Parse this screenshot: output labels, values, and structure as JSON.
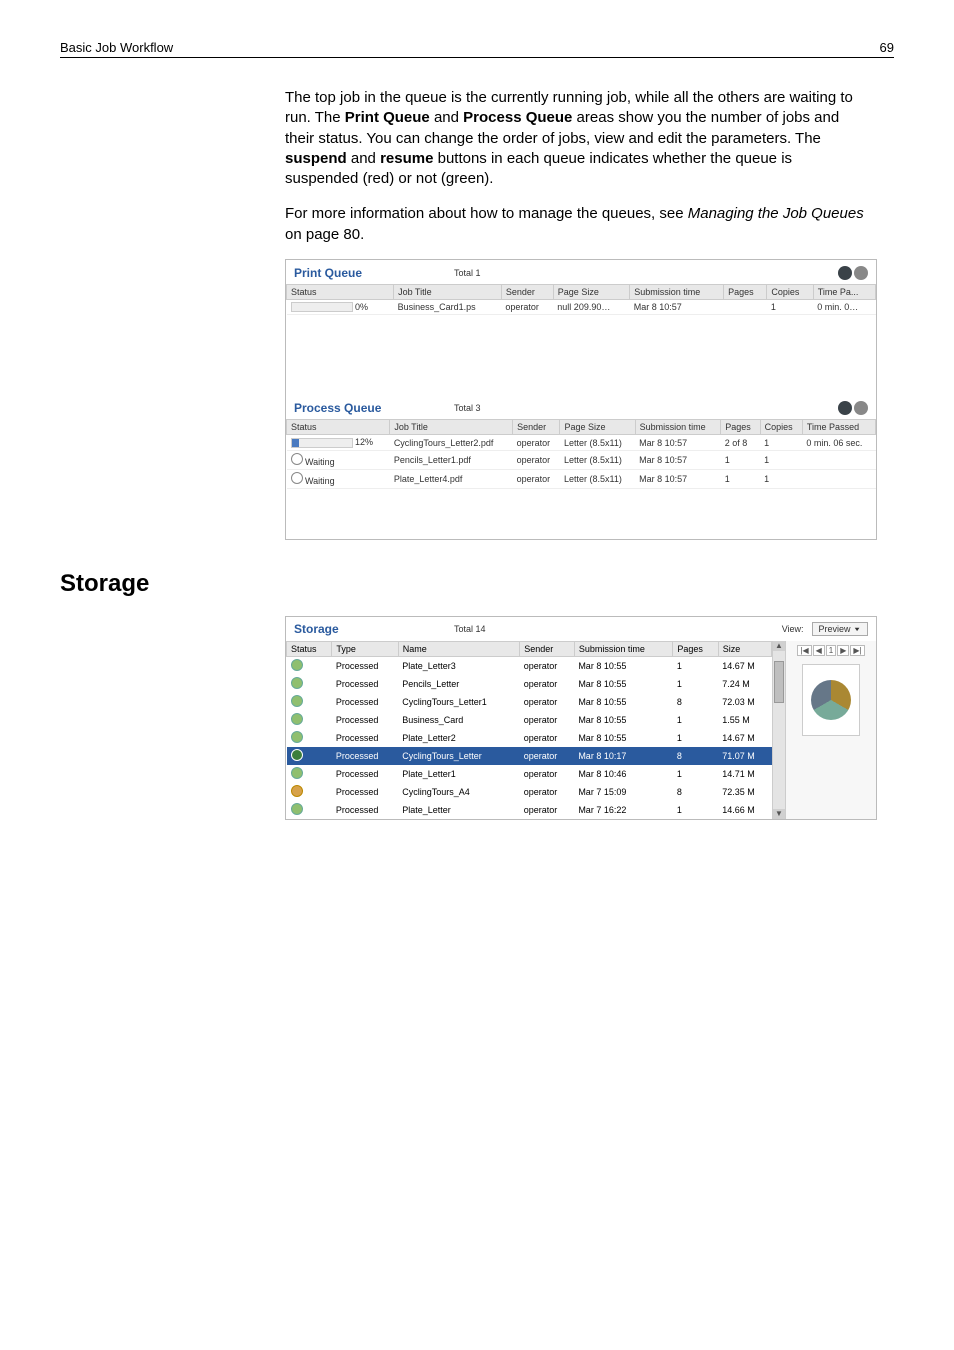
{
  "header": {
    "left": "Basic Job Workflow",
    "right": "69"
  },
  "para1_parts": {
    "a": "The top job in the queue is the currently running job, while all the others are waiting to run. The ",
    "b": "Print Queue",
    "c": " and ",
    "d": "Process Queue",
    "e": " areas show you the number of jobs and their status. You can change the order of jobs, view and edit the parameters. The ",
    "f": "suspend",
    "g": " and ",
    "h": "resume",
    "i": " buttons in each queue indicates whether the queue is suspended (red) or not (green)."
  },
  "para2_parts": {
    "a": "For more information about how to manage the queues, see ",
    "b": "Managing the Job Queues",
    "c": " on page 80."
  },
  "print_queue": {
    "title": "Print Queue",
    "total": "Total 1",
    "columns": [
      "Status",
      "Job Title",
      "Sender",
      "Page Size",
      "Submission time",
      "Pages",
      "Copies",
      "Time Pa..."
    ],
    "rows": [
      {
        "statusPct": "0%",
        "barPct": 0,
        "title": "Business_Card1.ps",
        "sender": "operator",
        "pageSize": "null 209.90…",
        "subTime": "Mar 8 10:57",
        "pages": "",
        "copies": "1",
        "time": "0 min. 0…"
      }
    ]
  },
  "process_queue": {
    "title": "Process Queue",
    "total": "Total 3",
    "columns": [
      "Status",
      "Job Title",
      "Sender",
      "Page Size",
      "Submission time",
      "Pages",
      "Copies",
      "Time Passed"
    ],
    "rows": [
      {
        "status": "12%",
        "barPct": 12,
        "title": "CyclingTours_Letter2.pdf",
        "sender": "operator",
        "pageSize": "Letter (8.5x11)",
        "subTime": "Mar 8 10:57",
        "pages": "2 of 8",
        "copies": "1",
        "time": "0 min. 06 sec."
      },
      {
        "status": "Waiting",
        "title": "Pencils_Letter1.pdf",
        "sender": "operator",
        "pageSize": "Letter (8.5x11)",
        "subTime": "Mar 8 10:57",
        "pages": "1",
        "copies": "1",
        "time": ""
      },
      {
        "status": "Waiting",
        "title": "Plate_Letter4.pdf",
        "sender": "operator",
        "pageSize": "Letter (8.5x11)",
        "subTime": "Mar 8 10:57",
        "pages": "1",
        "copies": "1",
        "time": ""
      }
    ]
  },
  "storage_heading": "Storage",
  "storage": {
    "title": "Storage",
    "total": "Total 14",
    "viewLabel": "View:",
    "preview": "Preview",
    "pager": [
      "|◀",
      "◀",
      "1",
      "▶",
      "▶|"
    ],
    "columns": [
      "Status",
      "Type",
      "Name",
      "Sender",
      "Submission time",
      "Pages",
      "Size"
    ],
    "rows": [
      {
        "type": "Processed",
        "name": "Plate_Letter3",
        "sender": "operator",
        "time": "Mar 8 10:55",
        "pages": "1",
        "size": "14.67 M",
        "sel": false,
        "kind": "ok"
      },
      {
        "type": "Processed",
        "name": "Pencils_Letter",
        "sender": "operator",
        "time": "Mar 8 10:55",
        "pages": "1",
        "size": "7.24 M",
        "sel": false,
        "kind": "ok"
      },
      {
        "type": "Processed",
        "name": "CyclingTours_Letter1",
        "sender": "operator",
        "time": "Mar 8 10:55",
        "pages": "8",
        "size": "72.03 M",
        "sel": false,
        "kind": "ok"
      },
      {
        "type": "Processed",
        "name": "Business_Card",
        "sender": "operator",
        "time": "Mar 8 10:55",
        "pages": "1",
        "size": "1.55 M",
        "sel": false,
        "kind": "ok"
      },
      {
        "type": "Processed",
        "name": "Plate_Letter2",
        "sender": "operator",
        "time": "Mar 8 10:55",
        "pages": "1",
        "size": "14.67 M",
        "sel": false,
        "kind": "ok"
      },
      {
        "type": "Processed",
        "name": "CyclingTours_Letter",
        "sender": "operator",
        "time": "Mar 8 10:17",
        "pages": "8",
        "size": "71.07 M",
        "sel": true,
        "kind": "ok"
      },
      {
        "type": "Processed",
        "name": "Plate_Letter1",
        "sender": "operator",
        "time": "Mar 8 10:46",
        "pages": "1",
        "size": "14.71 M",
        "sel": false,
        "kind": "ok"
      },
      {
        "type": "Processed",
        "name": "CyclingTours_A4",
        "sender": "operator",
        "time": "Mar 7 15:09",
        "pages": "8",
        "size": "72.35 M",
        "sel": false,
        "kind": "pause"
      },
      {
        "type": "Processed",
        "name": "Plate_Letter",
        "sender": "operator",
        "time": "Mar 7 16:22",
        "pages": "1",
        "size": "14.66 M",
        "sel": false,
        "kind": "ok"
      }
    ]
  }
}
